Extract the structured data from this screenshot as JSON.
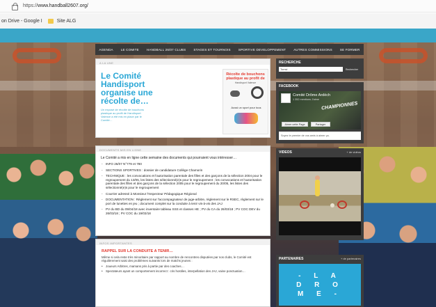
{
  "browser": {
    "url_prefix": "https://",
    "url_host": "www.handball2607.org/"
  },
  "bookmarks": {
    "items": [
      "on Drive - Google I",
      "Site ALG"
    ]
  },
  "nav": {
    "items": [
      "AGENDA",
      "LE COMITE",
      "HANDBALL 26/07 CLUBS",
      "STAGES ET TOURNOIS",
      "SPORTIVE DEVELOPPEMENT",
      "AUTRES COMMISSIONS",
      "SE FORMER"
    ]
  },
  "feature": {
    "header": "A LA UNE",
    "title": "Le Comité Handisport organise une récolte de…",
    "text": "Un exposé de récolte de bouchons plastique au profit de Handisport Valence a été mis en place par le Comité…",
    "image": {
      "title": "Récolte de bouchons plastique au profit de",
      "subtitle": "Handisport Valence",
      "caption": "Aussi un sport pour tous"
    }
  },
  "docs": {
    "header": "DOCUMENTS MIS EN LIGNE",
    "intro": "Le Comité a mis en ligne cette semaine des documents qui pourraient vous intéresser…",
    "items": [
      "INFO 26/07 N°779 et 780",
      "SECTIONS SPORTIVES : dossier de candidature Collège Chamorin",
      "TECHNIQUE : les convocations et l'autorisation parentale des filles et des garçons de la sélection 2004 pour le regroupement du 13/05, les listes des sélectionné(e)s pour le regroupement ; les convocations et l'autorisation parentale des filles et des garçons de la sélection 2005 pour le regroupement du 20/05, les listes des sélectionné(e)s pour le regroupement",
      "Courrier adressé à Monsieur l'Inspecteur Pédagogique Régional",
      "DOCUMENTATION : Règlement sur l'accompagnateur de juge-arbitre, règlement sur le RSEC, règlement sur le port de lunettes en jeu ; document complet sur la conduite à tenir vis-à-vis des JAJ",
      "PV du BD du 09/04/18 avec inventaire tableau SSS et classes HE ; PV du CA du 26/03/18 ; PV COC DEV du 26/03/18 ; PV COC du 19/03/18"
    ]
  },
  "news": {
    "header": "INFOS IMPORTANTES",
    "title": "RAPPEL SUR LA CONDUITE A TENIR…",
    "body": "Même si cela reste très minoritaire par rapport au nombre de rencontres disputées par nos clubs, le Comité est régulièrement saisi des problèmes suivants lors de matchs jeunes :",
    "bullets": [
      "Joueurs Arbitres, mamans pris à partie par des coaches…",
      "Spectateurs ayant un comportement incorrect : cris hostiles, interpellation des JAJ, vaine ponctuation…"
    ]
  },
  "sidebar": {
    "search": {
      "header": "RECHERCHE",
      "value": "Tomsi",
      "button": "Rechercher"
    },
    "facebook": {
      "header": "FACEBOOK",
      "page_name": "Comité Drôme Ardèch",
      "likes": "1 352 mentions J'aime",
      "like_button": "Aimer cette Page",
      "share_button": "Partager",
      "overlay": "CHAMPIONNES",
      "footer": "Soyez le premier de vos amis à aimer ça."
    },
    "videos": {
      "header": "VIDEOS",
      "more": "+ de vidéos"
    },
    "partners": {
      "header": "PARTENAIRES",
      "more": "+ de partenaires",
      "logo": "- L A\nD R O\nM E -"
    }
  }
}
